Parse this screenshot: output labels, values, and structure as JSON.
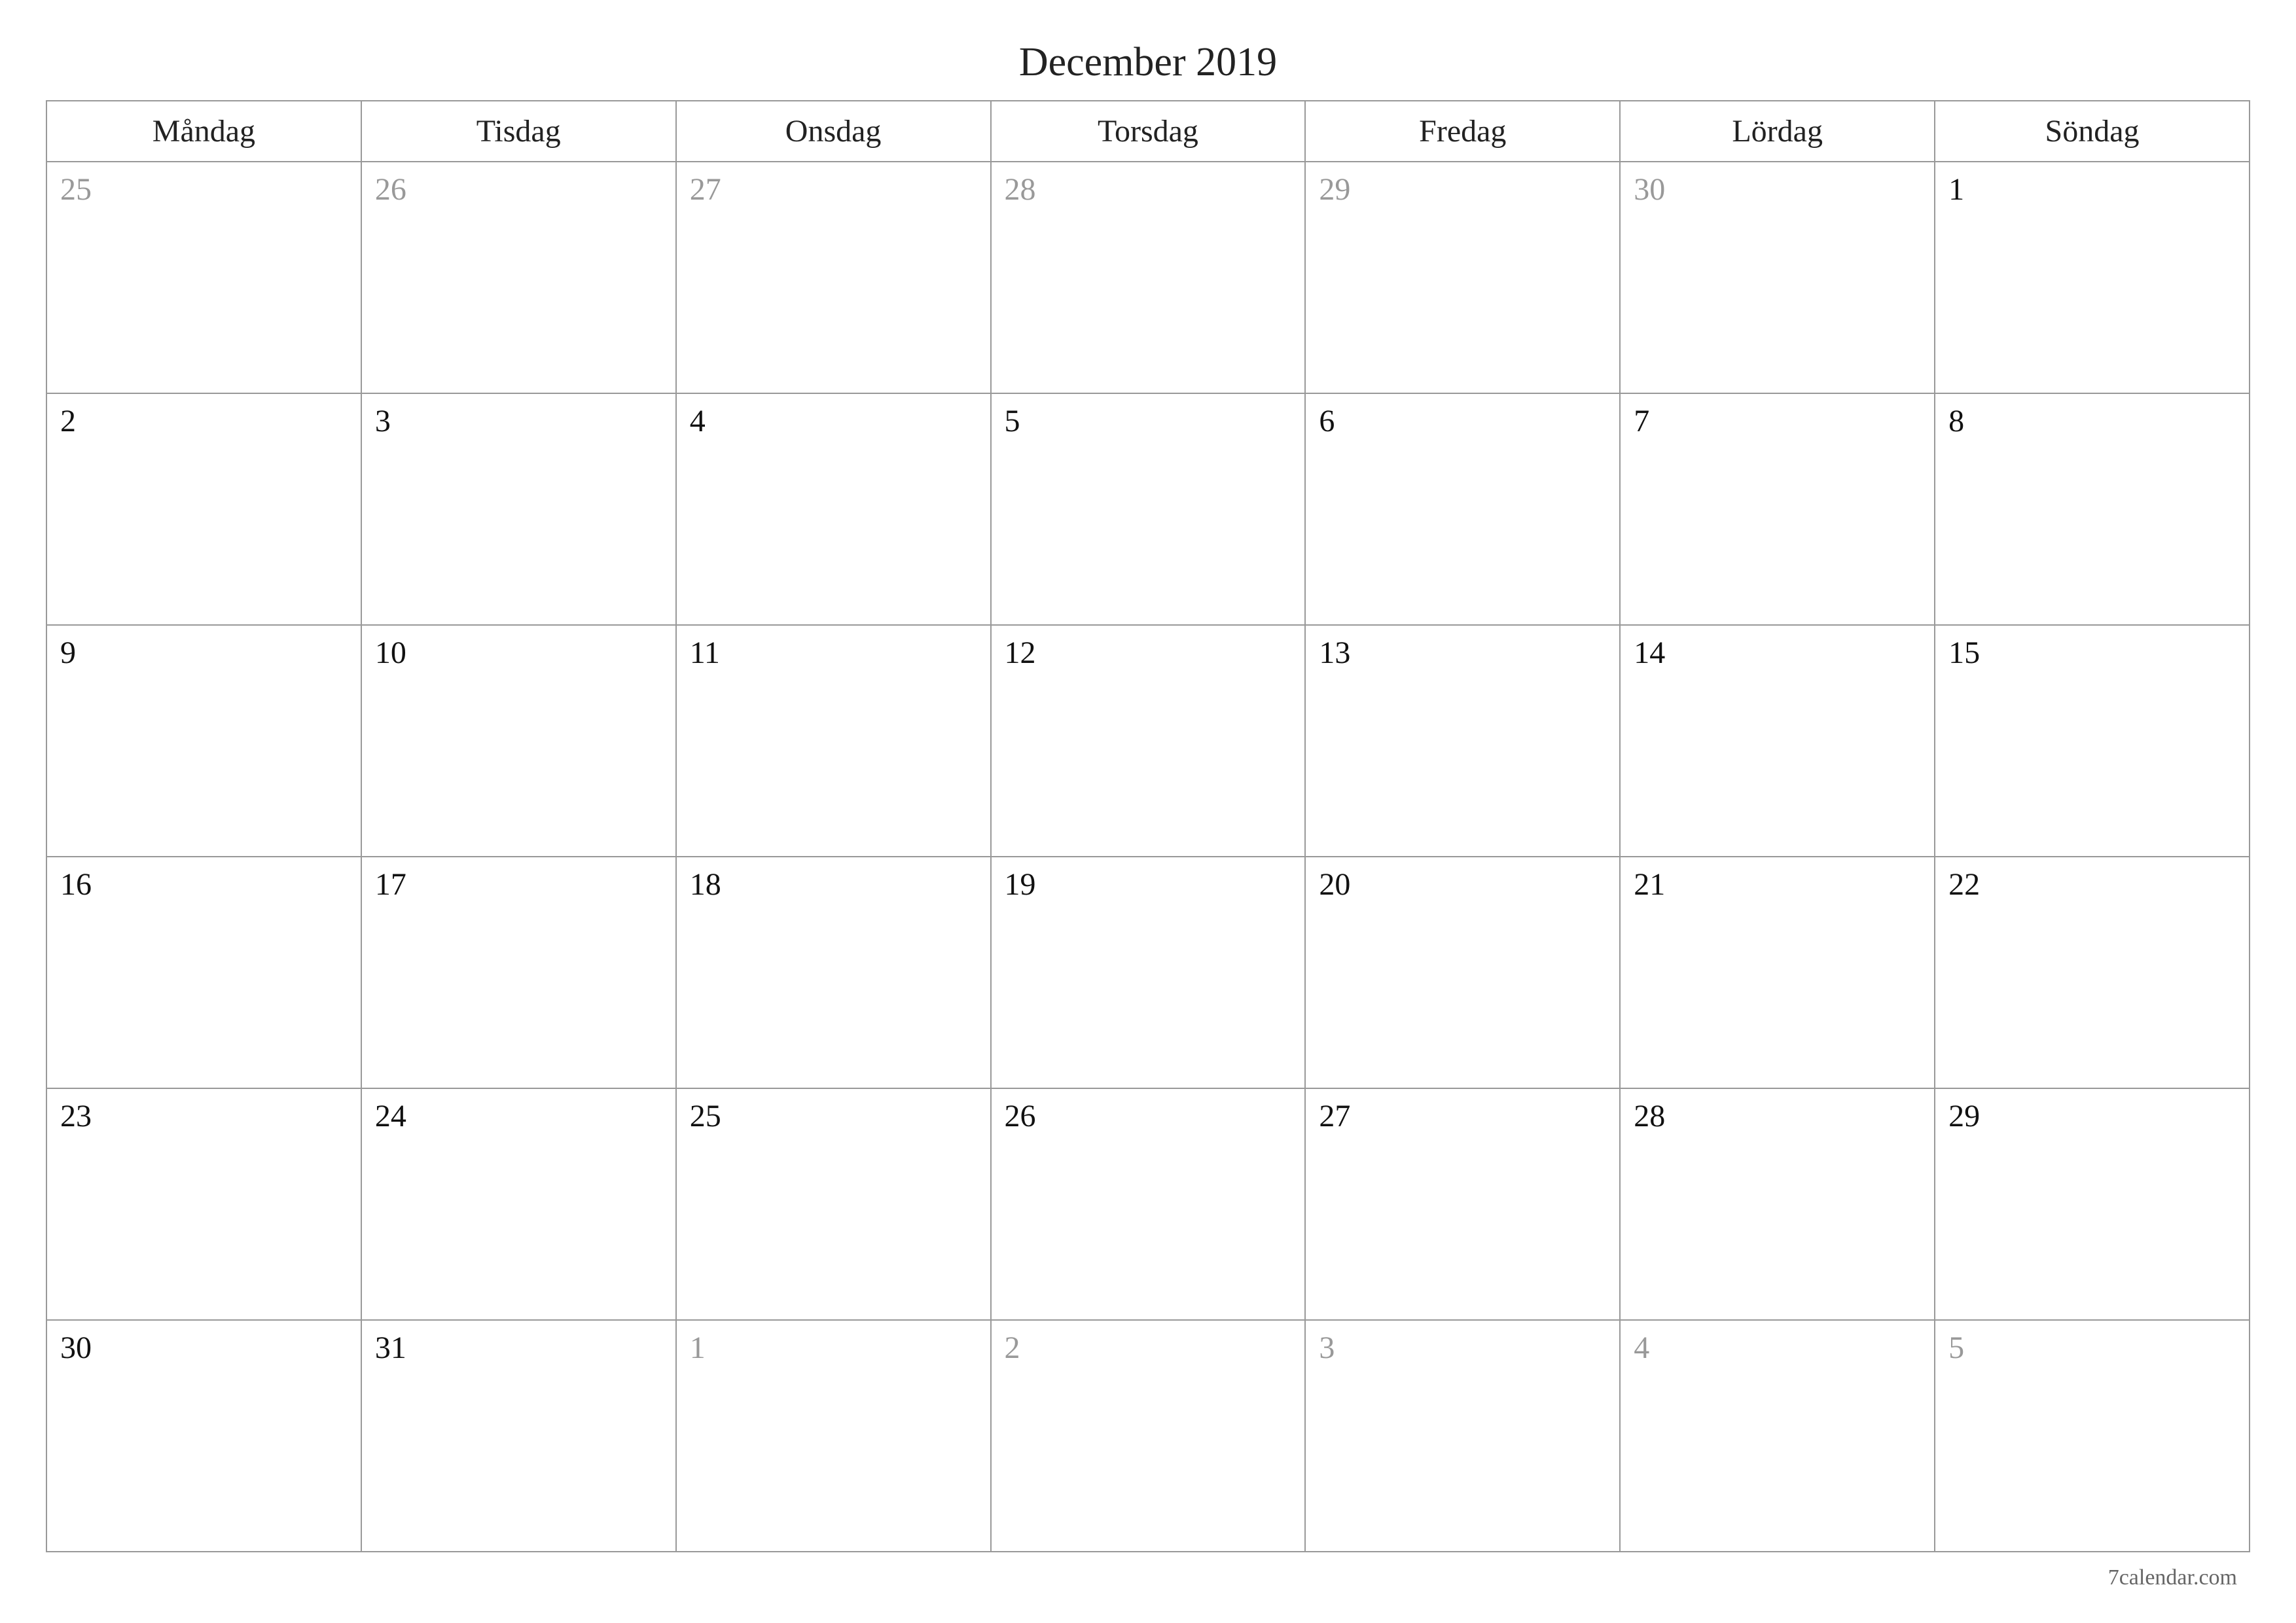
{
  "title": "December 2019",
  "weekdays": [
    "Måndag",
    "Tisdag",
    "Onsdag",
    "Torsdag",
    "Fredag",
    "Lördag",
    "Söndag"
  ],
  "weeks": [
    [
      {
        "day": "25",
        "out": true
      },
      {
        "day": "26",
        "out": true
      },
      {
        "day": "27",
        "out": true
      },
      {
        "day": "28",
        "out": true
      },
      {
        "day": "29",
        "out": true
      },
      {
        "day": "30",
        "out": true
      },
      {
        "day": "1",
        "out": false
      }
    ],
    [
      {
        "day": "2",
        "out": false
      },
      {
        "day": "3",
        "out": false
      },
      {
        "day": "4",
        "out": false
      },
      {
        "day": "5",
        "out": false
      },
      {
        "day": "6",
        "out": false
      },
      {
        "day": "7",
        "out": false
      },
      {
        "day": "8",
        "out": false
      }
    ],
    [
      {
        "day": "9",
        "out": false
      },
      {
        "day": "10",
        "out": false
      },
      {
        "day": "11",
        "out": false
      },
      {
        "day": "12",
        "out": false
      },
      {
        "day": "13",
        "out": false
      },
      {
        "day": "14",
        "out": false
      },
      {
        "day": "15",
        "out": false
      }
    ],
    [
      {
        "day": "16",
        "out": false
      },
      {
        "day": "17",
        "out": false
      },
      {
        "day": "18",
        "out": false
      },
      {
        "day": "19",
        "out": false
      },
      {
        "day": "20",
        "out": false
      },
      {
        "day": "21",
        "out": false
      },
      {
        "day": "22",
        "out": false
      }
    ],
    [
      {
        "day": "23",
        "out": false
      },
      {
        "day": "24",
        "out": false
      },
      {
        "day": "25",
        "out": false
      },
      {
        "day": "26",
        "out": false
      },
      {
        "day": "27",
        "out": false
      },
      {
        "day": "28",
        "out": false
      },
      {
        "day": "29",
        "out": false
      }
    ],
    [
      {
        "day": "30",
        "out": false
      },
      {
        "day": "31",
        "out": false
      },
      {
        "day": "1",
        "out": true
      },
      {
        "day": "2",
        "out": true
      },
      {
        "day": "3",
        "out": true
      },
      {
        "day": "4",
        "out": true
      },
      {
        "day": "5",
        "out": true
      }
    ]
  ],
  "footer": "7calendar.com"
}
